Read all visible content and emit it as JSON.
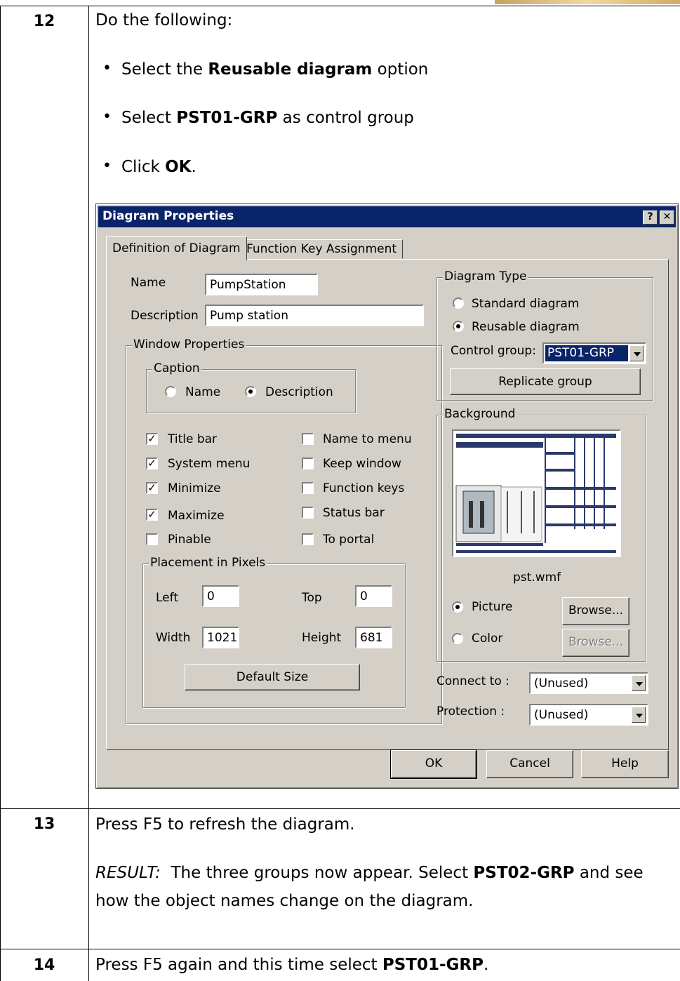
{
  "steps": [
    {
      "number": "12",
      "intro": "Do the following:",
      "bullets": [
        {
          "pre": "Select the ",
          "bold": "Reusable diagram",
          "post": " option"
        },
        {
          "pre": "Select ",
          "bold": "PST01-GRP",
          "post": " as control group"
        },
        {
          "pre": "Click ",
          "bold": "OK",
          "post": "."
        }
      ]
    },
    {
      "number": "13",
      "text": "Press F5 to refresh the diagram.",
      "result_label": "RESULT:",
      "result_pre": "  The three groups now appear. Select ",
      "result_bold": "PST02-GRP",
      "result_post": " and see",
      "result_line2": "how the object names change on the diagram."
    },
    {
      "number": "14",
      "pre": "Press F5 again and this time select ",
      "bold": "PST01-GRP",
      "post": "."
    }
  ],
  "dialog": {
    "title": "Diagram Properties",
    "help_btn": "?",
    "close_btn": "✕",
    "tabs": [
      "Definition of Diagram",
      "Function Key Assignment"
    ],
    "name_label": "Name",
    "name_value": "PumpStation",
    "desc_label": "Description",
    "desc_value": "Pump station",
    "window_props": "Window Properties",
    "caption": "Caption",
    "caption_name": "Name",
    "caption_desc": "Description",
    "checks_left": [
      {
        "label": "Title bar",
        "checked": true
      },
      {
        "label": "System menu",
        "checked": true
      },
      {
        "label": "Minimize",
        "checked": true
      },
      {
        "label": "Maximize",
        "checked": true
      },
      {
        "label": "Pinable",
        "checked": false
      }
    ],
    "checks_right": [
      {
        "label": "Name to menu",
        "checked": false
      },
      {
        "label": "Keep window",
        "checked": false
      },
      {
        "label": "Function keys",
        "checked": false
      },
      {
        "label": "Status bar",
        "checked": false
      },
      {
        "label": "To portal",
        "checked": false
      }
    ],
    "placement": "Placement in Pixels",
    "left_label": "Left",
    "left_value": "0",
    "top_label": "Top",
    "top_value": "0",
    "width_label": "Width",
    "width_value": "1021",
    "height_label": "Height",
    "height_value": "681",
    "default_size": "Default Size",
    "diagram_type": "Diagram Type",
    "standard": "Standard diagram",
    "reusable": "Reusable diagram",
    "control_group_label": "Control group:",
    "control_group_value": "PST01-GRP",
    "replicate": "Replicate group",
    "background": "Background",
    "bg_file": "pst.wmf",
    "picture": "Picture",
    "color": "Color",
    "browse": "Browse...",
    "connect_label": "Connect to :",
    "connect_value": "(Unused)",
    "protection_label": "Protection :",
    "protection_value": "(Unused)",
    "ok": "OK",
    "cancel": "Cancel",
    "help": "Help"
  }
}
